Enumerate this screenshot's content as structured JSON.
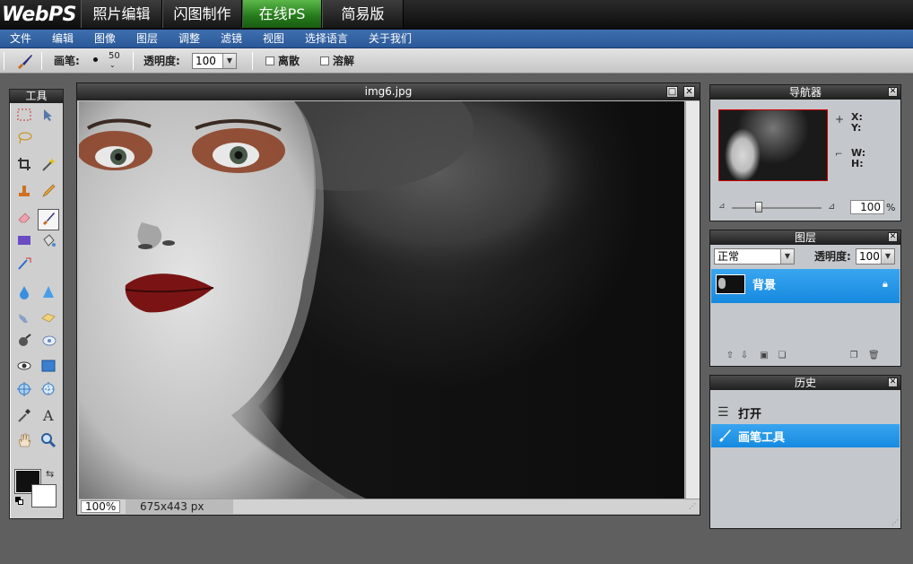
{
  "brand": {
    "logo": "WebPS",
    "tabs": [
      {
        "label": "照片编辑",
        "active": false
      },
      {
        "label": "闪图制作",
        "active": false
      },
      {
        "label": "在线PS",
        "active": true
      },
      {
        "label": "简易版",
        "active": false
      }
    ]
  },
  "menubar": {
    "items": [
      "文件",
      "编辑",
      "图像",
      "图层",
      "调整",
      "滤镜",
      "视图",
      "选择语言",
      "关于我们"
    ]
  },
  "optionsbar": {
    "brush_label": "画笔:",
    "brush_size": "50",
    "opacity_label": "透明度:",
    "opacity_value": "100",
    "scatter_label": "离散",
    "dissolve_label": "溶解"
  },
  "tools": {
    "title": "工具",
    "icons": [
      "rect-marquee-icon",
      "move-icon",
      "lasso-icon",
      "magic-wand-icon",
      "crop-icon",
      "wand-sparkle-icon",
      "stamp-icon",
      "pencil-icon",
      "eraser-icon",
      "brush-icon",
      "rect-shape-icon",
      "paint-bucket-icon",
      "color-replace-icon",
      "blur-icon",
      "sharpen-icon",
      "smudge-icon",
      "sponge-icon",
      "burn-icon",
      "dodge-icon",
      "red-eye-icon",
      "rectangle-icon",
      "bloat-icon",
      "pinch-icon",
      "eyedropper-icon",
      "text-icon",
      "hand-icon",
      "zoom-icon"
    ],
    "selected": "brush-icon",
    "colors": {
      "foreground": "#111111",
      "background": "#ffffff"
    }
  },
  "document": {
    "title": "img6.jpg",
    "zoom": "100%",
    "size": "675x443 px"
  },
  "navigator": {
    "title": "导航器",
    "x_label": "X:",
    "y_label": "Y:",
    "w_label": "W:",
    "h_label": "H:",
    "zoom_value": "100",
    "zoom_unit": "%"
  },
  "layers": {
    "title": "图层",
    "blend_mode": "正常",
    "opacity_label": "透明度:",
    "opacity_value": "100",
    "items": [
      {
        "name": "背景",
        "locked": true,
        "selected": true
      }
    ]
  },
  "history": {
    "title": "历史",
    "items": [
      {
        "label": "打开",
        "icon": "document-icon",
        "selected": false
      },
      {
        "label": "画笔工具",
        "icon": "brush-icon",
        "selected": true
      }
    ]
  },
  "colors": {
    "accent": "#1e8fe6",
    "menubar": "#3a69a8",
    "active_tab": "#2f8c22"
  }
}
